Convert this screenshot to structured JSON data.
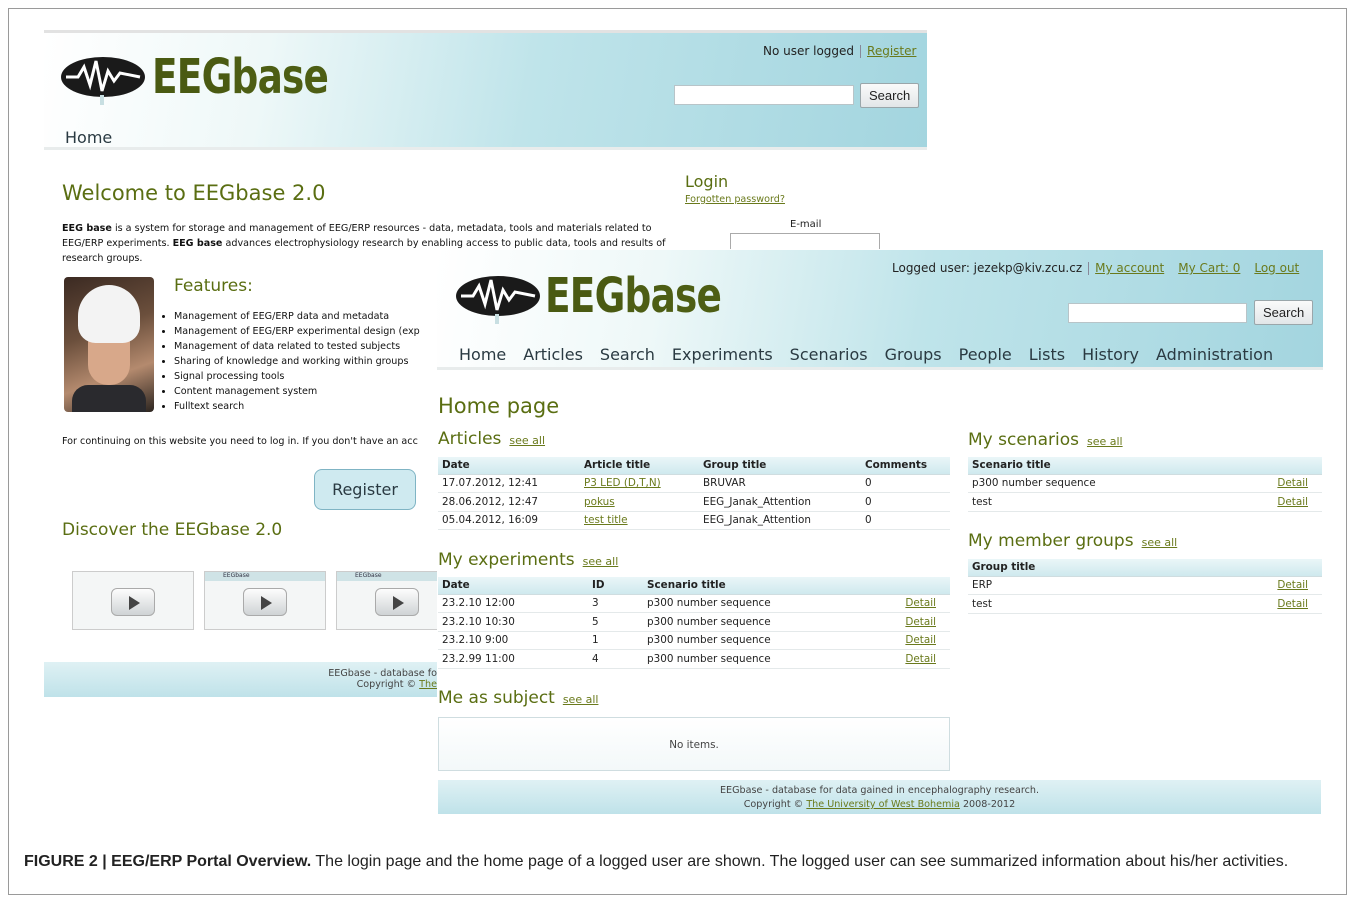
{
  "login_page": {
    "header": {
      "logo_text_a": "EEG",
      "logo_text_b": "base",
      "no_user": "No user logged",
      "register_link": "Register",
      "search_button": "Search",
      "nav_home": "Home"
    },
    "welcome_title": "Welcome to EEGbase 2.0",
    "desc_b1": "EEG base",
    "desc_t1": " is a system for storage and management of EEG/ERP resources - data, metadata, tools and materials related to EEG/ERP experiments. ",
    "desc_b2": "EEG base",
    "desc_t2": " advances electrophysiology research by enabling access to public data, tools and results of research groups.",
    "features_title": "Features:",
    "features": [
      "Management of EEG/ERP data and metadata",
      "Management of EEG/ERP experimental design (exp",
      "Management of data related to tested subjects",
      "Sharing of knowledge and working within groups",
      "Signal processing tools",
      "Content management system",
      "Fulltext search"
    ],
    "continue_text": "For continuing on this website you need to log in. If you don't have an acc",
    "register_button": "Register",
    "discover_title": "Discover the EEGbase 2.0",
    "thumb_label": "EEGbase",
    "login_title": "Login",
    "forgot_link": "Forgotten password?",
    "email_label": "E-mail",
    "footer_line1": "EEGbase - database fo",
    "footer_copy": "Copyright © ",
    "footer_link": "The"
  },
  "home_page": {
    "header": {
      "logo_text_a": "EEG",
      "logo_text_b": "base",
      "logged_user": "Logged user: jezekp@kiv.zcu.cz",
      "my_account": "My account",
      "my_cart": "My Cart: 0",
      "log_out": "Log out",
      "search_button": "Search",
      "nav": [
        "Home",
        "Articles",
        "Search",
        "Experiments",
        "Scenarios",
        "Groups",
        "People",
        "Lists",
        "History",
        "Administration"
      ]
    },
    "title": "Home page",
    "see_all": "see all",
    "articles": {
      "title": "Articles",
      "columns": [
        "Date",
        "Article title",
        "Group title",
        "Comments"
      ],
      "rows": [
        [
          "17.07.2012, 12:41",
          "P3 LED (D,T,N)",
          "BRUVAR",
          "0"
        ],
        [
          "28.06.2012, 12:47",
          "pokus",
          "EEG_Janak_Attention",
          "0"
        ],
        [
          "05.04.2012, 16:09",
          "test title",
          "EEG_Janak_Attention",
          "0"
        ]
      ]
    },
    "experiments": {
      "title": "My experiments",
      "columns": [
        "Date",
        "ID",
        "Scenario title",
        ""
      ],
      "rows": [
        [
          "23.2.10 12:00",
          "3",
          "p300 number sequence",
          "Detail"
        ],
        [
          "23.2.10 10:30",
          "5",
          "p300 number sequence",
          "Detail"
        ],
        [
          "23.2.10 9:00",
          "1",
          "p300 number sequence",
          "Detail"
        ],
        [
          "23.2.99 11:00",
          "4",
          "p300 number sequence",
          "Detail"
        ]
      ]
    },
    "subject": {
      "title": "Me as subject",
      "no_items": "No items."
    },
    "scenarios": {
      "title": "My scenarios",
      "columns": [
        "Scenario title",
        ""
      ],
      "rows": [
        [
          "p300 number sequence",
          "Detail"
        ],
        [
          "test",
          "Detail"
        ]
      ]
    },
    "groups": {
      "title": "My member groups",
      "columns": [
        "Group title",
        ""
      ],
      "rows": [
        [
          "ERP",
          "Detail"
        ],
        [
          "test",
          "Detail"
        ]
      ]
    },
    "footer_line1": "EEGbase - database for data gained in encephalography research.",
    "footer_copy": "Copyright © ",
    "footer_link": "The University of West Bohemia",
    "footer_years": " 2008-2012"
  },
  "caption": {
    "label": "FIGURE 2 | EEG/ERP Portal Overview.",
    "text": " The login page and the home page of a logged user are shown. The logged user can see summarized information about his/her activities."
  }
}
